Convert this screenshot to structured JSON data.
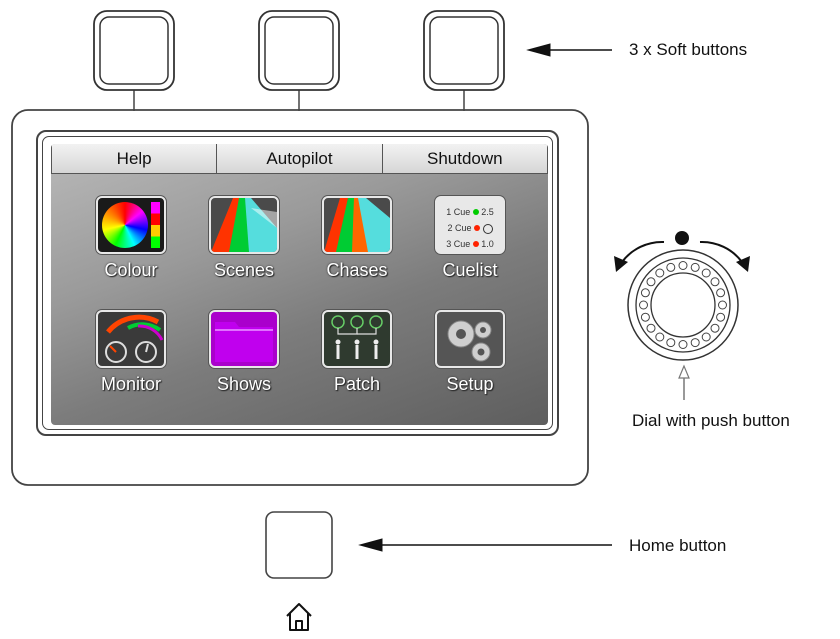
{
  "soft_buttons_label": "3 x Soft buttons",
  "dial_label": "Dial with push button",
  "home_label": "Home button",
  "tabs": [
    "Help",
    "Autopilot",
    "Shutdown"
  ],
  "apps": [
    {
      "label": "Colour",
      "icon": "colour-wheel-icon"
    },
    {
      "label": "Scenes",
      "icon": "scenes-beams-icon"
    },
    {
      "label": "Chases",
      "icon": "chases-beams-icon"
    },
    {
      "label": "Cuelist",
      "icon": "cuelist-icon"
    },
    {
      "label": "Monitor",
      "icon": "monitor-gauges-icon"
    },
    {
      "label": "Shows",
      "icon": "folder-icon"
    },
    {
      "label": "Patch",
      "icon": "patch-fixtures-icon"
    },
    {
      "label": "Setup",
      "icon": "gears-icon"
    }
  ],
  "cuelist_rows": [
    {
      "num": "1",
      "name": "Cue",
      "val": "2.5"
    },
    {
      "num": "2",
      "name": "Cue",
      "val": ""
    },
    {
      "num": "3",
      "name": "Cue",
      "val": "1.0"
    }
  ],
  "colors": {
    "arrow": "#111111",
    "outline": "#444444"
  }
}
